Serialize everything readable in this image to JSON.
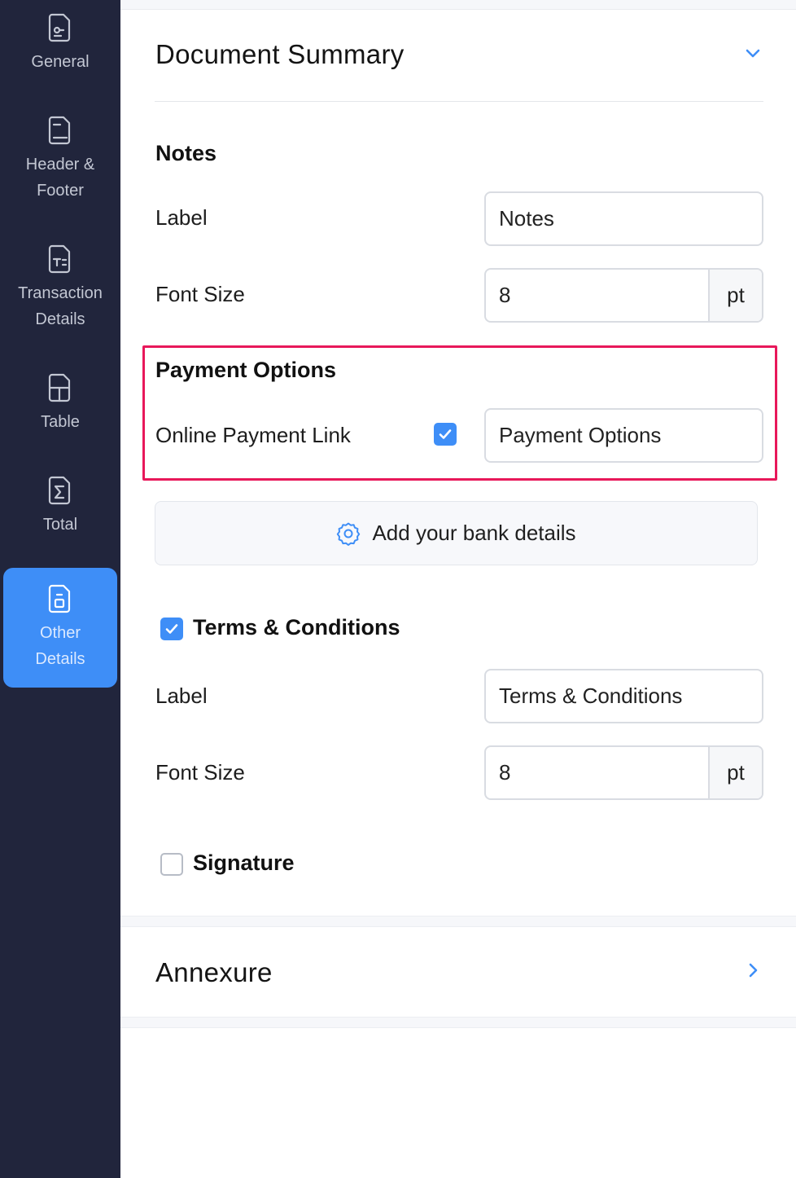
{
  "sidebar": {
    "items": [
      {
        "label": "General",
        "icon": "document-link-icon",
        "active": false
      },
      {
        "label": "Header &\nFooter",
        "icon": "document-header-icon",
        "active": false
      },
      {
        "label": "Transaction\nDetails",
        "icon": "document-text-icon",
        "active": false
      },
      {
        "label": "Table",
        "icon": "document-table-icon",
        "active": false
      },
      {
        "label": "Total",
        "icon": "document-sigma-icon",
        "active": false
      },
      {
        "label": "Other\nDetails",
        "icon": "document-other-icon",
        "active": true
      }
    ]
  },
  "main": {
    "document_summary": {
      "title": "Document Summary",
      "notes": {
        "heading": "Notes",
        "label_text": "Label",
        "label_value": "Notes",
        "font_size_text": "Font Size",
        "font_size_value": "8",
        "font_size_unit": "pt"
      },
      "payment_options": {
        "heading": "Payment Options",
        "online_payment_label": "Online Payment Link",
        "online_payment_checked": true,
        "label_value": "Payment Options"
      },
      "bank_button_label": "Add your bank details",
      "terms": {
        "heading": "Terms & Conditions",
        "checked": true,
        "label_text": "Label",
        "label_value": "Terms & Conditions",
        "font_size_text": "Font Size",
        "font_size_value": "8",
        "font_size_unit": "pt"
      },
      "signature": {
        "heading": "Signature",
        "checked": false
      }
    },
    "annexure": {
      "title": "Annexure"
    }
  },
  "colors": {
    "sidebar_bg": "#21253c",
    "accent": "#3e8ef7",
    "highlight_border": "#e8185a"
  }
}
